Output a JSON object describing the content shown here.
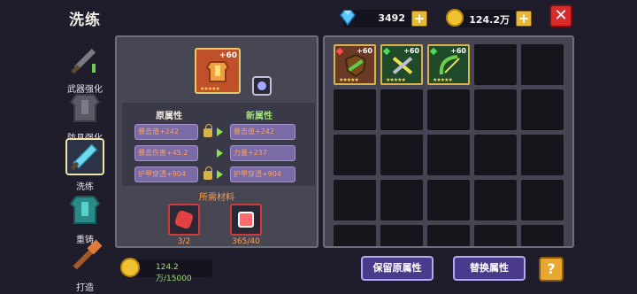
{
  "page_title": "洗练",
  "currency": {
    "gems": "3492",
    "gold": "124.2万"
  },
  "nav": [
    {
      "label": "武器强化"
    },
    {
      "label": "防具强化"
    },
    {
      "label": "洗练"
    },
    {
      "label": "重铸"
    },
    {
      "label": "打造"
    }
  ],
  "item": {
    "level": "+60",
    "stars": "★★★★★"
  },
  "attributes": {
    "old_header": "原属性",
    "new_header": "新属性",
    "rows": [
      {
        "old": "暴击值+242",
        "new": "暴击值+242",
        "locked": true
      },
      {
        "old": "暴击伤害+45.2",
        "new": "力量+237",
        "locked": false
      },
      {
        "old": "护甲穿透+904",
        "new": "护甲穿透+904",
        "locked": true
      }
    ]
  },
  "materials": {
    "title": "所需材料",
    "items": [
      {
        "count": "3/2"
      },
      {
        "count": "365/40"
      }
    ]
  },
  "gold_cost": "124.2万/15000",
  "inventory": [
    {
      "level": "+60",
      "stars": "★★★★★"
    },
    {
      "level": "+60",
      "stars": "★★★★★"
    },
    {
      "level": "+60",
      "stars": "★★★★★"
    }
  ],
  "buttons": {
    "keep": "保留原属性",
    "replace": "替换属性",
    "help": "?",
    "close": "✕",
    "plus": "+"
  },
  "colors": {
    "accent_old": "#ffa15a",
    "accent_new": "#9fe07b",
    "button": "#4a3a8c"
  }
}
